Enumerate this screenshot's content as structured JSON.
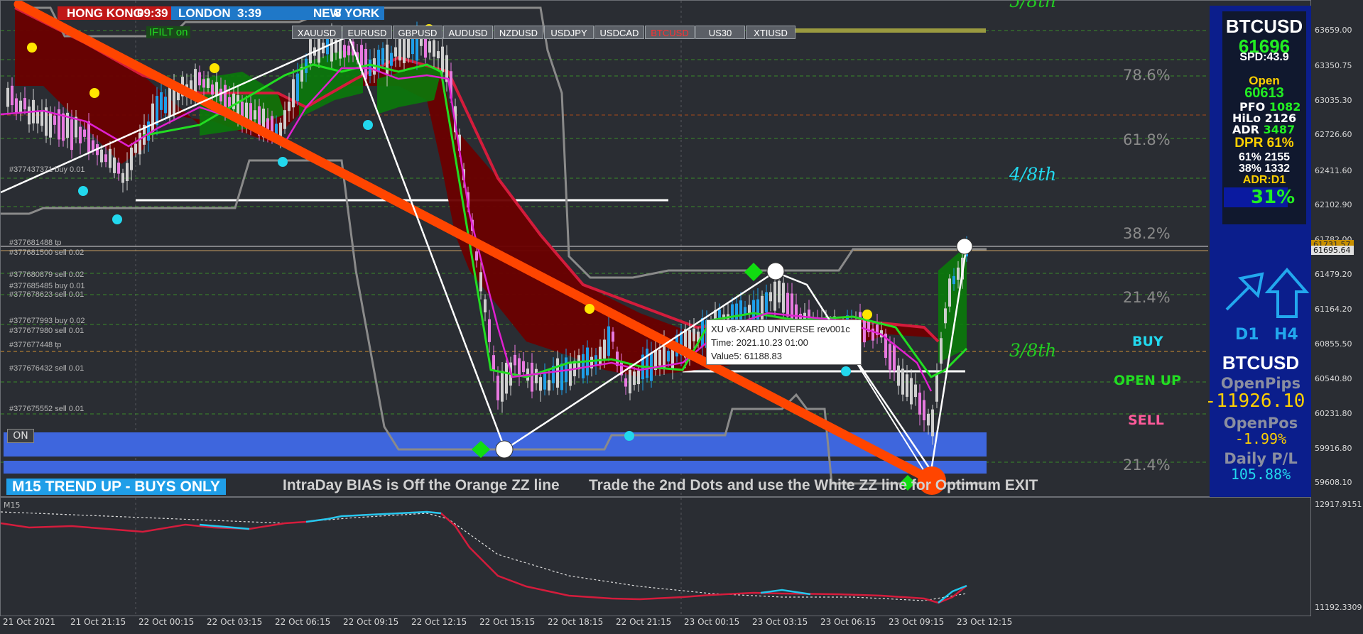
{
  "sessions": {
    "hong_kong": "HONG KONG",
    "hong_kong_time": "09:39",
    "london": "LONDON",
    "london_time": "3:39",
    "new_york": "NEW YORK",
    "new_york_time": "8"
  },
  "ifilt": "IFILT on",
  "symbols": [
    "XAUUSD",
    "EURUSD",
    "GBPUSD",
    "AUDUSD",
    "NZDUSD",
    "USDJPY",
    "USDCAD",
    "BTCUSD",
    "US30",
    "XTIUSD"
  ],
  "active_symbol": "BTCUSD",
  "colors": {
    "accent_red": "#d41c3c",
    "zigzag_orange": "#ff4500",
    "bull_candle": "#1e9ee8",
    "bear_candle": "#e879e0",
    "support_band": "#3e66dd",
    "panel_blue": "#0b1e8c"
  },
  "price_axis": [
    "63659.00",
    "63350.75",
    "63035.30",
    "62726.60",
    "62411.60",
    "62102.90",
    "61782.00",
    "61479.20",
    "61164.20",
    "60855.50",
    "60540.80",
    "60231.80",
    "59916.80",
    "59608.10"
  ],
  "price_boxes": {
    "current": "61695.64",
    "prev": "61731.57"
  },
  "indicator_axis": [
    "12917.9151",
    "11192.3309"
  ],
  "indicator_title": "M15",
  "time_axis": [
    "21 Oct 2021",
    "21 Oct 21:15",
    "22 Oct 00:15",
    "22 Oct 03:15",
    "22 Oct 06:15",
    "22 Oct 09:15",
    "22 Oct 12:15",
    "22 Oct 15:15",
    "22 Oct 18:15",
    "22 Oct 21:15",
    "23 Oct 00:15",
    "23 Oct 03:15",
    "23 Oct 06:15",
    "23 Oct 09:15",
    "23 Oct 12:15"
  ],
  "orders": [
    "#377437371 buy 0.01",
    "#377681488 tp",
    "#377681500 sell 0.02",
    "#377680879 sell 0.02",
    "#377685485 buy 0.01",
    "#377678623 sell 0.01",
    "#377677993 buy 0.02",
    "#377677980 sell 0.01",
    "#377677448 tp",
    "#377676432 sell 0.01",
    "#377675552 sell 0.01"
  ],
  "fib_levels": [
    "78.6%",
    "61.8%",
    "38.2%",
    "21.4%",
    "21.4%"
  ],
  "octaves": [
    "5/8th",
    "4/8th",
    "3/8th"
  ],
  "signals": {
    "buy": "BUY",
    "open_up": "OPEN UP",
    "sell": "SELL"
  },
  "on_button": "ON",
  "trend_banner": "M15 TREND UP - BUYS ONLY",
  "bias_text": "IntraDay BIAS is Off the Orange ZZ line",
  "trade_text": "Trade the 2nd Dots and use the White ZZ line for Optimum EXIT",
  "tooltip": {
    "line1": "XU v8-XARD UNIVERSE rev001c",
    "line2": "Time: 2021.10.23 01:00",
    "line3": "Value5: 61188.83"
  },
  "dashboard": {
    "symbol": "BTCUSD",
    "price": "61696",
    "spd": "SPD:43.9",
    "open_label": "Open",
    "open_value": "60613",
    "pfo_label": "PFO",
    "pfo_value": "1082",
    "hilo_label": "HiLo",
    "hilo_value": "2126",
    "adr_label": "ADR",
    "adr_value": "3487",
    "dpr": "DPR 61%",
    "pct61": "61% 2155",
    "pct38": "38% 1332",
    "adr_tf": "ADR:D1",
    "pct": "31%"
  },
  "tf_labels": {
    "d1": "D1",
    "h4": "H4"
  },
  "bottom_panel": {
    "symbol": "BTCUSD",
    "open_pips_label": "OpenPips",
    "open_pips_value": "-11926.10",
    "open_pos_label": "OpenPos",
    "open_pos_value": "-1.99%",
    "daily_pl_label": "Daily P/L",
    "daily_pl_value": "105.88%"
  }
}
